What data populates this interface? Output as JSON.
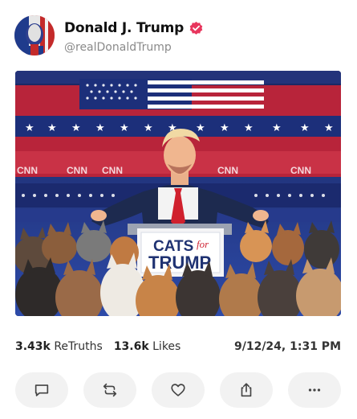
{
  "post": {
    "display_name": "Donald J. Trump",
    "handle": "@realDonaldTrump",
    "verified": true,
    "accent_color": "#e8365d"
  },
  "image": {
    "podium_line1": "CATS",
    "podium_line2": "for",
    "podium_line3": "TRUMP",
    "banner_texts": [
      "CNN",
      "CNN",
      "CNN",
      "CNN",
      "CNN",
      "CNN"
    ]
  },
  "stats": {
    "retruths_count": "3.43k",
    "retruths_label": "ReTruths",
    "likes_count": "13.6k",
    "likes_label": "Likes",
    "timestamp": "9/12/24, 1:31 PM"
  },
  "actions": [
    {
      "icon": "reply-icon"
    },
    {
      "icon": "retruth-icon"
    },
    {
      "icon": "like-icon"
    },
    {
      "icon": "share-icon"
    },
    {
      "icon": "more-icon"
    }
  ]
}
